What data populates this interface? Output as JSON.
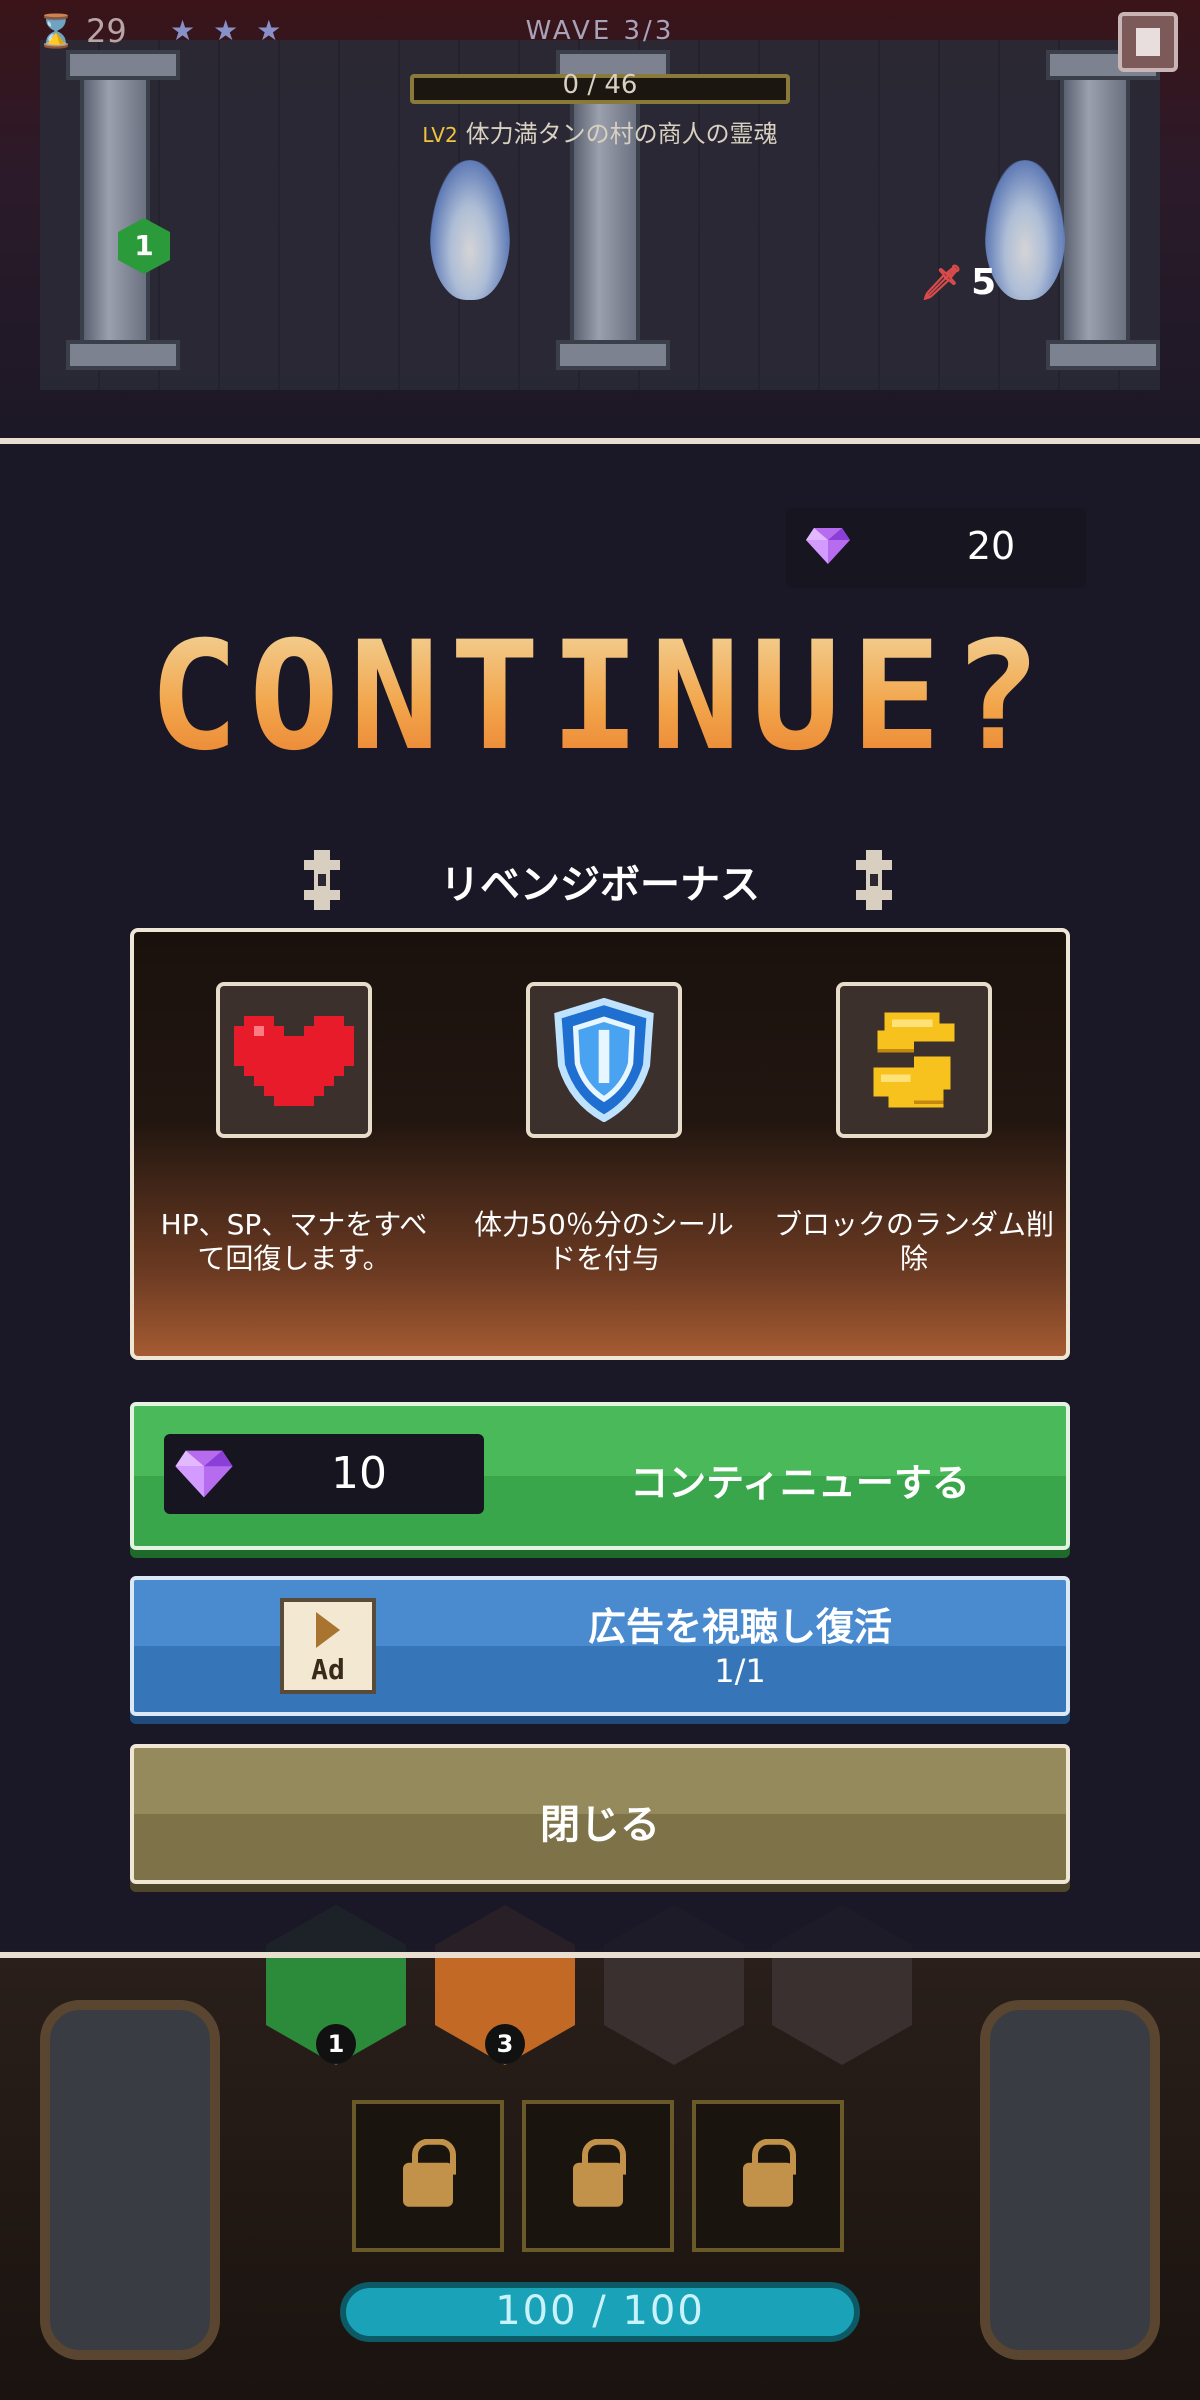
{
  "hud": {
    "timer": "29",
    "stars": "★★★",
    "wave": "WAVE 3/3",
    "boss_bar_text": "0 / 46",
    "boss_level": "LV2",
    "boss_name": "体力満タンの村の商人の霊魂",
    "hero_badge": "1",
    "sword_count": "5"
  },
  "bottom": {
    "hero_levels": [
      "1",
      "3"
    ],
    "hp_text": "100 / 100"
  },
  "modal": {
    "gem_balance": "20",
    "title": "CONTINUE?",
    "revenge_title": "リベンジボーナス",
    "bonuses": [
      {
        "icon": "heart-icon",
        "text": "HP、SP、マナをすべて回復します。"
      },
      {
        "icon": "shield-icon",
        "text": "体力50％分のシールドを付与"
      },
      {
        "icon": "block-shuffle-icon",
        "text": "ブロックのランダム削除"
      }
    ],
    "continue_button": {
      "price": "10",
      "label": "コンティニューする"
    },
    "ad_button": {
      "icon_text": "Ad",
      "label": "広告を視聴し復活",
      "count": "1/1"
    },
    "close_button": {
      "label": "閉じる"
    }
  },
  "colors": {
    "title_gradient_top": "#f3d9a2",
    "title_gradient_bottom": "#e87b2c",
    "continue_green": "#49b959",
    "ad_blue": "#4a8bd0",
    "close_khaki": "#958a5c"
  }
}
